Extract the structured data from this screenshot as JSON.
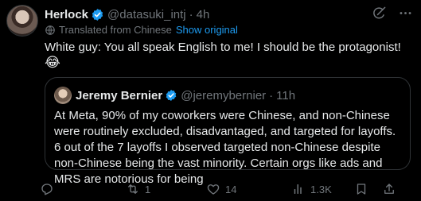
{
  "post": {
    "display_name": "Herlock",
    "handle": "@datasuki_intj",
    "separator": "·",
    "time": "4h",
    "translated_label": "Translated from Chinese",
    "show_original": "Show original",
    "text": "White guy: You all speak English to me! I should be the protagonist!",
    "emoji": "😂"
  },
  "quote": {
    "display_name": "Jeremy Bernier",
    "handle": "@jeremybernier",
    "separator": "·",
    "time": "11h",
    "text": "At Meta, 90% of my coworkers were Chinese, and non-Chinese were routinely excluded, disadvantaged, and targeted for layoffs. 6 out of the 7 layoffs I observed targeted non-Chinese despite non-Chinese being the vast minority. Certain orgs like ads and MRS are notorious for being"
  },
  "actions": {
    "replies": "",
    "reposts": "1",
    "likes": "14",
    "views": "1.3K"
  },
  "icons": {
    "grok": "grok-icon",
    "more": "more-icon",
    "globe": "globe-icon",
    "reply": "reply-icon",
    "repost": "repost-icon",
    "like": "heart-icon",
    "views": "views-icon",
    "bookmark": "bookmark-icon",
    "share": "share-icon"
  },
  "colors": {
    "background": "#000000",
    "text": "#e7e9ea",
    "muted": "#71767b",
    "link": "#1d9bf0",
    "verified": "#1d9bf0",
    "border": "#2f3336"
  }
}
